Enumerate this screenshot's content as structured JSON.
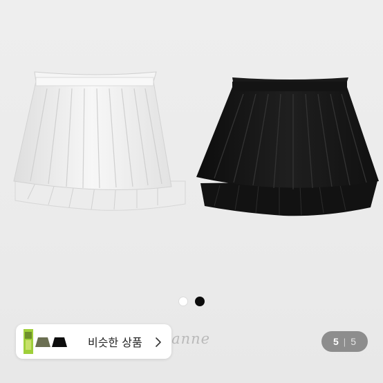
{
  "image_viewer": {
    "product_images": [
      {
        "name": "white-pleated-skirt",
        "color": "#f4f4f4"
      },
      {
        "name": "black-pleated-skirt",
        "color": "#161616"
      }
    ],
    "color_swatches": [
      {
        "name": "white",
        "color": "#ffffff"
      },
      {
        "name": "black",
        "color": "#0c0c0c"
      }
    ],
    "brand_watermark": "zanne"
  },
  "similar_products": {
    "label": "비슷한 상품",
    "icon": "chevron-right-icon"
  },
  "pagination": {
    "current": "5",
    "separator": "|",
    "total": "5"
  }
}
